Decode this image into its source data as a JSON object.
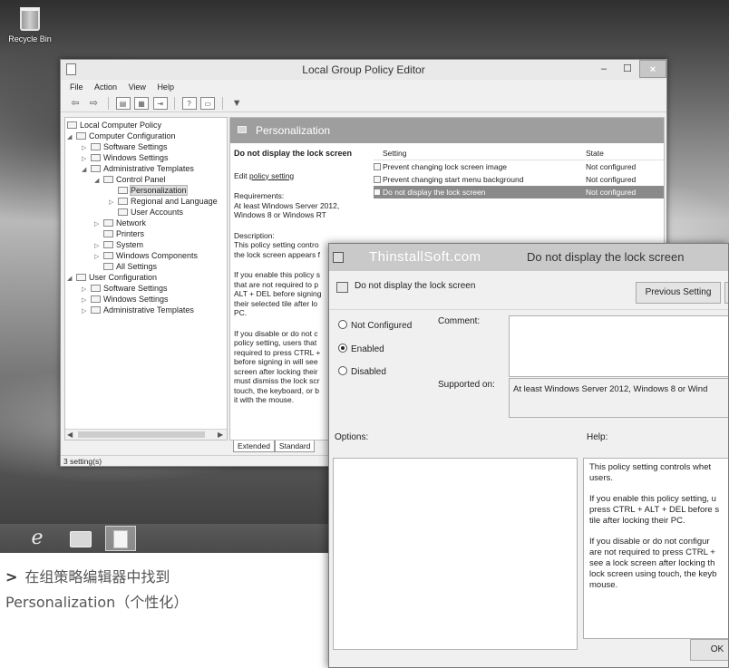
{
  "desktop": {
    "recycle_bin_label": "Recycle Bin",
    "taskbar": {
      "items": [
        "internet-explorer",
        "file-explorer",
        "group-policy-editor"
      ],
      "ie_glyph": "e"
    }
  },
  "gpe": {
    "title": "Local Group Policy Editor",
    "window_buttons": {
      "minimize": "–",
      "maximize": "☐",
      "close": "×"
    },
    "menu": [
      "File",
      "Action",
      "View",
      "Help"
    ],
    "tree": {
      "items": [
        {
          "label": "Local Computer Policy",
          "icon": "policy-icon",
          "twisty": ""
        },
        {
          "label": "Computer Configuration",
          "icon": "computer-icon",
          "twisty": "◢"
        },
        {
          "label": "Software Settings",
          "icon": "folder-icon",
          "twisty": "▷"
        },
        {
          "label": "Windows Settings",
          "icon": "folder-icon",
          "twisty": "▷"
        },
        {
          "label": "Administrative Templates",
          "icon": "folder-icon",
          "twisty": "◢"
        },
        {
          "label": "Control Panel",
          "icon": "folder-icon",
          "twisty": "◢"
        },
        {
          "label": "Personalization",
          "icon": "folder-icon",
          "twisty": "",
          "selected": true
        },
        {
          "label": "Regional and Language",
          "icon": "folder-icon",
          "twisty": "▷"
        },
        {
          "label": "User Accounts",
          "icon": "folder-icon",
          "twisty": ""
        },
        {
          "label": "Network",
          "icon": "folder-icon",
          "twisty": "▷"
        },
        {
          "label": "Printers",
          "icon": "folder-icon",
          "twisty": ""
        },
        {
          "label": "System",
          "icon": "folder-icon",
          "twisty": "▷"
        },
        {
          "label": "Windows Components",
          "icon": "folder-icon",
          "twisty": "▷"
        },
        {
          "label": "All Settings",
          "icon": "folder-icon",
          "twisty": ""
        },
        {
          "label": "User Configuration",
          "icon": "user-icon",
          "twisty": "◢"
        },
        {
          "label": "Software Settings",
          "icon": "folder-icon",
          "twisty": "▷"
        },
        {
          "label": "Windows Settings",
          "icon": "folder-icon",
          "twisty": "▷"
        },
        {
          "label": "Administrative Templates",
          "icon": "folder-icon",
          "twisty": "▷"
        }
      ]
    },
    "pane_title": "Personalization",
    "description": {
      "title": "Do not display the lock screen",
      "edit_prefix": "Edit ",
      "edit_link": "policy setting",
      "requirements": "Requirements:\nAt least Windows Server 2012,\nWindows 8 or Windows RT",
      "desc1": "Description:\nThis policy setting contro\nthe lock screen appears f",
      "desc2": "If you enable this policy s\nthat are not required to p\nALT + DEL before signing\ntheir selected tile after lo\nPC.",
      "desc3": "If you disable or do not c\npolicy setting, users that\nrequired to press CTRL +\nbefore signing in will see\nscreen after locking their\nmust dismiss the lock scr\ntouch, the keyboard, or b\nit with the mouse."
    },
    "columns": {
      "setting": "Setting",
      "state": "State"
    },
    "rows": [
      {
        "setting": "Prevent changing lock screen image",
        "state": "Not configured"
      },
      {
        "setting": "Prevent changing start menu background",
        "state": "Not configured"
      },
      {
        "setting": "Do not display the lock screen",
        "state": "Not configured",
        "selected": true
      }
    ],
    "tabs": [
      "Extended",
      "Standard"
    ],
    "status": "3 setting(s)"
  },
  "dialog": {
    "watermark": "ThinstallSoft.com",
    "title": "Do not display the lock screen",
    "header_label": "Do not display the lock screen",
    "previous_button": "Previous Setting",
    "radios": [
      "Not Configured",
      "Enabled",
      "Disabled"
    ],
    "selected_radio": "Enabled",
    "comment_label": "Comment:",
    "supported_label": "Supported on:",
    "supported_value": "At least Windows Server 2012, Windows 8 or Wind",
    "options_label": "Options:",
    "help_label": "Help:",
    "help_p1": "This policy setting controls whet\nusers.",
    "help_p2": "If you enable this policy setting, u\npress CTRL + ALT + DEL before s\ntile after  locking their PC.",
    "help_p3": "If you disable or do not configur\nare not required to press CTRL +\nsee a lock screen after locking th\nlock screen using touch, the keyb\nmouse.",
    "ok_button": "OK"
  },
  "caption": {
    "arrow": ">",
    "line1": "在组策略编辑器中找到",
    "line2": "Personalization（个性化）"
  }
}
